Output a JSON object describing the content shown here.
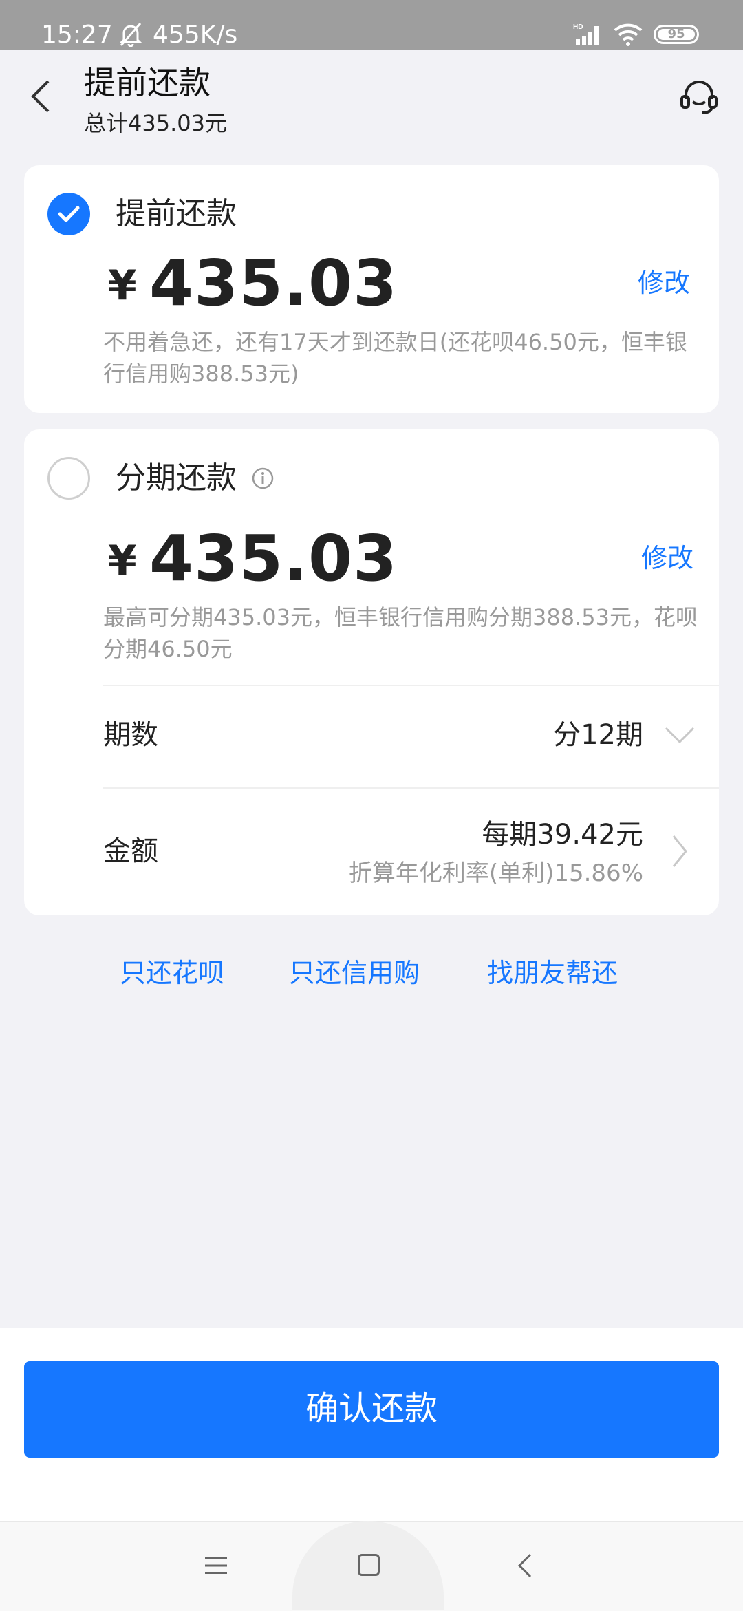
{
  "status_bar": {
    "time": "15:27",
    "net_speed": "455K/s",
    "battery": "95",
    "icons": [
      "bell-off-icon",
      "hd-signal-icon",
      "wifi-icon",
      "battery-icon"
    ]
  },
  "header": {
    "title": "提前还款",
    "subtitle": "总计435.03元",
    "back_icon": "chevron-left-icon",
    "service_icon": "customer-service-headset-icon"
  },
  "options": [
    {
      "title": "提前还款",
      "selected": true,
      "currency": "¥",
      "amount": "435.03",
      "edit_label": "修改",
      "description": "不用着急还，还有17天才到还款日(还花呗46.50元，恒丰银行信用购388.53元)"
    },
    {
      "title": "分期还款",
      "selected": false,
      "currency": "¥",
      "amount": "435.03",
      "edit_label": "修改",
      "description": "最高可分期435.03元，恒丰银行信用购分期388.53元，花呗分期46.50元",
      "term_label": "期数",
      "term_value": "分12期",
      "amount_label": "金额",
      "per_period": "每期39.42元",
      "rate_note": "折算年化利率(单利)15.86%"
    }
  ],
  "links": [
    "只还花呗",
    "只还信用购",
    "找朋友帮还"
  ],
  "confirm_button": "确认还款",
  "colors": {
    "accent": "#1677ff",
    "background": "#f2f2f6",
    "status_bar": "#9e9e9e"
  }
}
